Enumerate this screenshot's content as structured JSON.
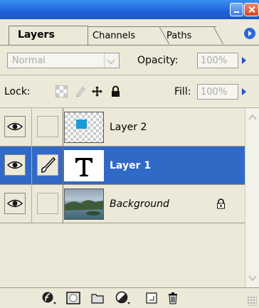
{
  "window": {
    "minimize_icon": "minimize-icon",
    "close_icon": "close-icon"
  },
  "tabs": [
    {
      "label": "Layers",
      "active": true
    },
    {
      "label": "Channels",
      "active": false
    },
    {
      "label": "Paths",
      "active": false
    }
  ],
  "blend_mode": {
    "value": "Normal"
  },
  "opacity": {
    "label": "Opacity:",
    "value": "100%"
  },
  "lock": {
    "label": "Lock:",
    "icons": [
      "lock-transparent-icon",
      "lock-paint-icon",
      "lock-move-icon",
      "lock-all-icon"
    ]
  },
  "fill": {
    "label": "Fill:",
    "value": "100%"
  },
  "layers": [
    {
      "name": "Layer 2",
      "selected": false,
      "visible": true,
      "linked_icon": ""
    },
    {
      "name": "Layer 1",
      "selected": true,
      "visible": true,
      "linked_icon": "brush-icon"
    },
    {
      "name": "Background",
      "selected": false,
      "visible": true,
      "locked": true
    }
  ],
  "colors": {
    "selection": "#3169c6",
    "accent_blue": "#2b67d6"
  },
  "footer_icons": [
    "layer-style-icon",
    "layer-mask-icon",
    "new-group-icon",
    "adjustment-layer-icon",
    "new-layer-icon",
    "trash-icon"
  ]
}
